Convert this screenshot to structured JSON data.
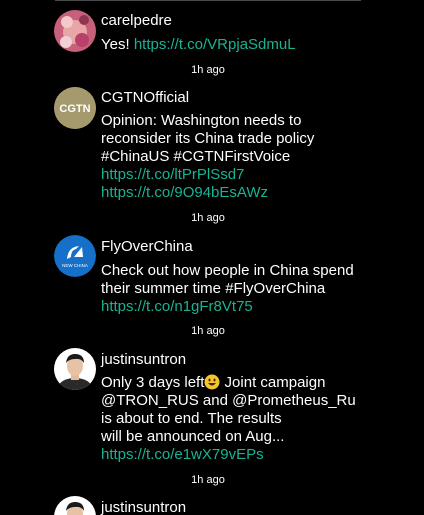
{
  "tweets": [
    {
      "handle": "carelpedre",
      "text_lines": [
        "Yes! "
      ],
      "link": "https://t.co/VRpjaSdmuL",
      "time": "1h ago"
    },
    {
      "handle": "CGTNOfficial",
      "avatar_label": "CGTN",
      "text_lines": [
        "Opinion: Washington needs to",
        "reconsider its China trade policy",
        "#ChinaUS #CGTNFirstVoice"
      ],
      "links": [
        "https://t.co/ltPrPlSsd7",
        "https://t.co/9O94bEsAWz"
      ],
      "time": "1h ago"
    },
    {
      "handle": "FlyOverChina",
      "avatar_label": "NEW CHINA",
      "text_lines": [
        "Check out how people in China spend",
        "their summer time #FlyOverChina"
      ],
      "link": "https://t.co/n1gFr8Vt75",
      "time": "1h ago"
    },
    {
      "handle": "justinsuntron",
      "text_lines": [
        "Only 3 days left",
        " Joint campaign",
        "@TRON_RUS and @Prometheus_Ru",
        "is about to end. The results",
        "will be announced on Aug..."
      ],
      "link": "https://t.co/e1wX79vEPs",
      "time": "1h ago"
    },
    {
      "handle": "justinsuntron"
    }
  ],
  "colors": {
    "background": "#000000",
    "link": "#19b394",
    "text": "#ffffff",
    "cgtn_avatar": "#a59a6e",
    "xinhua_avatar": "#1670c9"
  }
}
